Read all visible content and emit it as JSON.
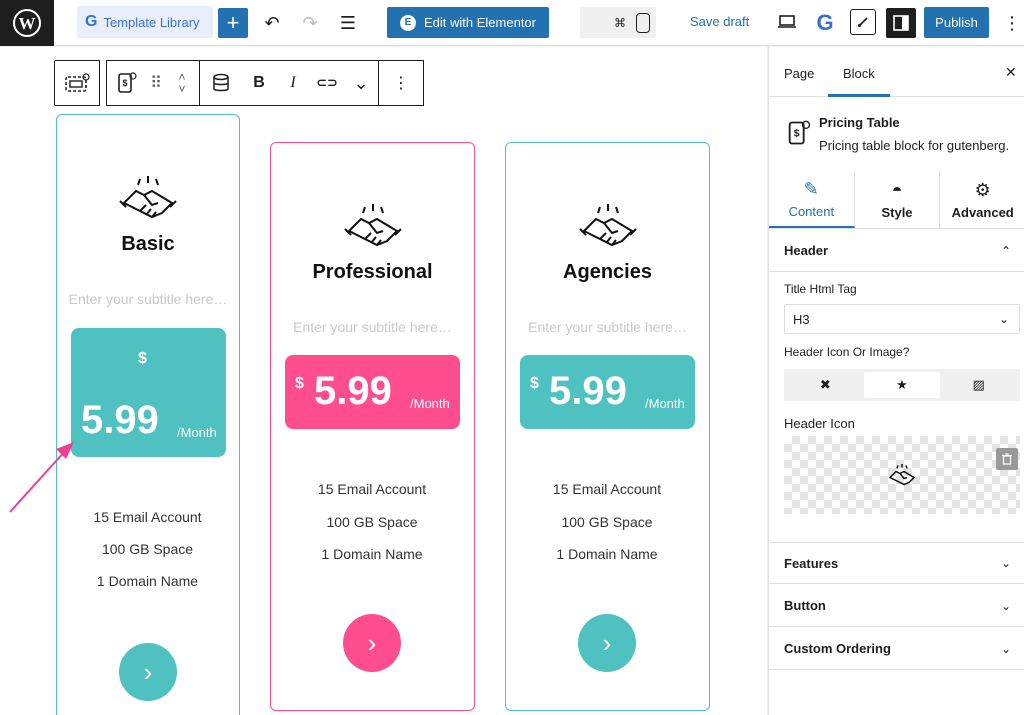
{
  "topbar": {
    "template_library": "Template Library",
    "template_library_g": "G",
    "plus": "+",
    "undo": "↶",
    "redo": "↷",
    "list_view": "☰",
    "edit_elementor": "Edit with Elementor",
    "elementor_e": "E",
    "command_symbol": "⌘",
    "save_draft": "Save draft",
    "g_logo": "G",
    "publish": "Publish",
    "options": "⋮"
  },
  "block_toolbar": {
    "drag": "⠿",
    "up": "˄",
    "down": "˅",
    "bold": "B",
    "italic": "I",
    "link": "⊂⊃",
    "more_chev": "⌄",
    "more": "⋮"
  },
  "cards": [
    {
      "title": "Basic",
      "subtitle": "Enter your subtitle here…",
      "currency": "$",
      "price": "5.99",
      "period": "/Month",
      "features": [
        "15 Email Account",
        "100 GB Space",
        "1 Domain Name"
      ],
      "button": "›"
    },
    {
      "title": "Professional",
      "subtitle": "Enter your subtitle here…",
      "currency": "$",
      "price": "5.99",
      "period": "/Month",
      "features": [
        "15 Email Account",
        "100 GB Space",
        "1 Domain Name"
      ],
      "button": "›"
    },
    {
      "title": "Agencies",
      "subtitle": "Enter your subtitle here…",
      "currency": "$",
      "price": "5.99",
      "period": "/Month",
      "features": [
        "15 Email Account",
        "100 GB Space",
        "1 Domain Name"
      ],
      "button": "›"
    }
  ],
  "colors": {
    "teal": "#4fc1c1",
    "pink": "#ff4d8d",
    "wp_blue": "#2271b1",
    "arrow": "#ef3f93"
  },
  "panel": {
    "tab_page": "Page",
    "tab_block": "Block",
    "close": "✕",
    "block_name": "Pricing Table",
    "block_desc": "Pricing table block for gutenberg.",
    "subtab_content": "Content",
    "subtab_style": "Style",
    "subtab_advanced": "Advanced",
    "header_section": "Header",
    "title_html_tag_label": "Title Html Tag",
    "title_html_tag_value": "H3",
    "header_icon_or_image_label": "Header Icon Or Image?",
    "header_icon_label": "Header Icon",
    "features_section": "Features",
    "button_section": "Button",
    "custom_ordering_section": "Custom Ordering",
    "chev_up": "⌃",
    "chev_down": "⌄",
    "seg_none": "✖",
    "seg_icon": "★",
    "seg_image": "▨",
    "trash": "🗑"
  }
}
